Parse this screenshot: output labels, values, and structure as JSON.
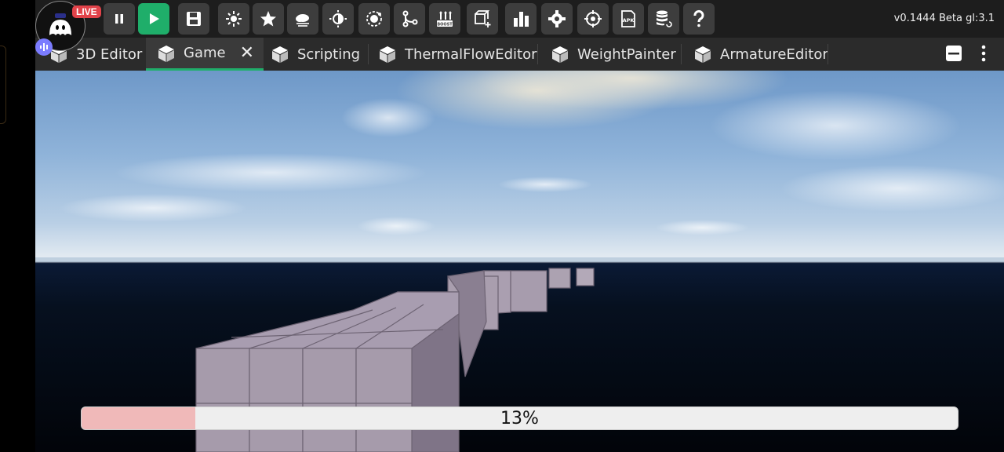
{
  "toolbar": {
    "version": "v0.1444 Beta gl:3.1",
    "buttons": [
      {
        "name": "pause-icon"
      },
      {
        "name": "play-icon"
      },
      {
        "name": "save-icon"
      },
      {
        "name": "sun-icon"
      },
      {
        "name": "star-icon"
      },
      {
        "name": "cloud-icon"
      },
      {
        "name": "brightness-icon"
      },
      {
        "name": "orbit-icon"
      },
      {
        "name": "nodes-icon"
      },
      {
        "name": "boost-icon",
        "label": "BOOST"
      },
      {
        "name": "add-object-icon"
      },
      {
        "name": "chart-icon"
      },
      {
        "name": "settings-icon"
      },
      {
        "name": "target-icon"
      },
      {
        "name": "apk-icon",
        "label": "APK"
      },
      {
        "name": "database-icon"
      },
      {
        "name": "help-icon"
      }
    ],
    "accent": "#1fae6a"
  },
  "live": {
    "label": "LIVE"
  },
  "tabs": [
    {
      "label": "3D Editor"
    },
    {
      "label": "Game",
      "active": true
    },
    {
      "label": "Scripting"
    },
    {
      "label": "ThermalFlowEditor"
    },
    {
      "label": "WeightPainter"
    },
    {
      "label": "ArmatureEditor"
    }
  ],
  "progress": {
    "text": "13%",
    "value": 0.13
  }
}
